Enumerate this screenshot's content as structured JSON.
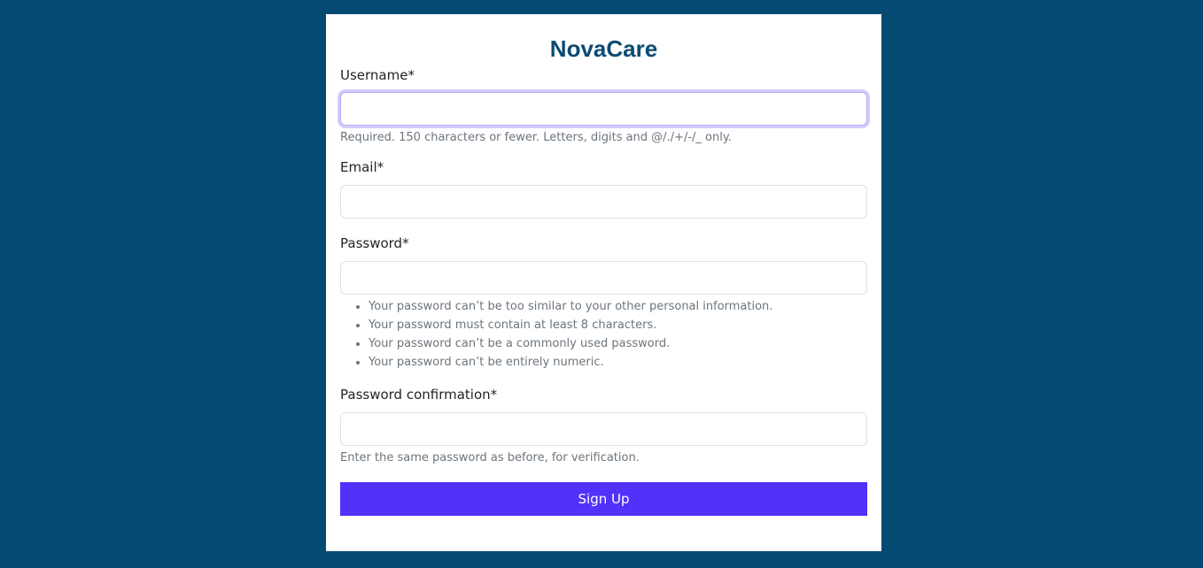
{
  "brand": "NovaCare",
  "form": {
    "username": {
      "label": "Username*",
      "value": "",
      "help": "Required. 150 characters or fewer. Letters, digits and @/./+/-/_ only."
    },
    "email": {
      "label": "Email*",
      "value": ""
    },
    "password": {
      "label": "Password*",
      "value": "",
      "rules": [
        "Your password can’t be too similar to your other personal information.",
        "Your password must contain at least 8 characters.",
        "Your password can’t be a commonly used password.",
        "Your password can’t be entirely numeric."
      ]
    },
    "password_confirmation": {
      "label": "Password confirmation*",
      "value": "",
      "help": "Enter the same password as before, for verification."
    },
    "submit_label": "Sign Up"
  },
  "colors": {
    "page_background": "#054a72",
    "brand_text": "#0a4b72",
    "button_background": "#5231fb",
    "focus_ring": "#b7aaf7"
  }
}
